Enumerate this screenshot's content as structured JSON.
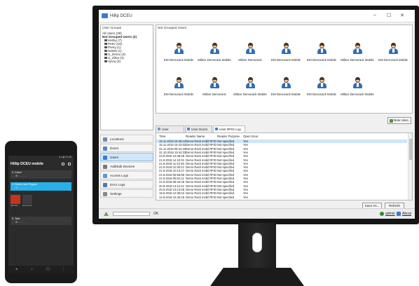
{
  "window": {
    "title": "Hillip DCEU",
    "minimize": "–",
    "maximize": "☐",
    "close": "✕"
  },
  "user_groups": {
    "title": "User Groups",
    "items": [
      {
        "label": "All Users (39)",
        "bold": false,
        "sub": false
      },
      {
        "label": "Not Grouped Users (2)",
        "bold": true,
        "sub": false
      },
      {
        "label": "Hezky (7)",
        "bold": false,
        "sub": true
      },
      {
        "label": "Petrv (18)",
        "bold": false,
        "sub": true
      },
      {
        "label": "Pvery (1)",
        "bold": false,
        "sub": true
      },
      {
        "label": "Sasek (1)",
        "bold": false,
        "sub": true
      },
      {
        "label": "U_Demo (3)",
        "bold": false,
        "sub": true
      },
      {
        "label": "U_Zlina (4)",
        "bold": false,
        "sub": true
      },
      {
        "label": "Vyvoj (3)",
        "bold": false,
        "sub": true
      }
    ]
  },
  "nav": [
    {
      "label": "Locations",
      "color": "#6b8fb5",
      "active": false
    },
    {
      "label": "Doors",
      "color": "#5c86c2",
      "active": false
    },
    {
      "label": "Users",
      "color": "#3a7bd5",
      "active": true
    },
    {
      "label": "Add/Edit Devices",
      "color": "#7a7a7a",
      "active": false
    },
    {
      "label": "Access Logs",
      "color": "#5b9bd5",
      "active": false
    },
    {
      "label": "Error Logs",
      "color": "#4a78b5",
      "active": false
    },
    {
      "label": "Settings",
      "color": "#8a8a8a",
      "active": false
    }
  ],
  "not_grouped": {
    "title": "Not Grouped Users",
    "row1": [
      "EM Demorack Mobile",
      "Mifare Demorack Mobile",
      "Mifare Demorack",
      "EM Demorack Mobile",
      "EM Demorack Mobile",
      "Mifare Demorack Mobile",
      "EM Demorack Mobile"
    ],
    "row2": [
      "EM Demorack Mobile",
      "Mifare Demorack",
      "Mifare Demorack Mobile",
      "EM Demorack Mobile",
      "EM Demorack Mobile",
      "Mifare Demorack Mobile"
    ]
  },
  "buttons": {
    "new_user": "New User...",
    "save_as": "Save As...",
    "refresh": "Refresh"
  },
  "tabs": [
    {
      "label": "User Parameters",
      "selected": false
    },
    {
      "label": "User Doors",
      "selected": false
    },
    {
      "label": "User RFID Log",
      "selected": true
    }
  ],
  "log": {
    "columns": [
      "Time",
      "Reader Name",
      "Reader Purpose",
      "Open Door"
    ],
    "rows": [
      [
        "15.11.2018 15:45:12",
        "Demo Rack mobil RFID",
        "Not specified",
        "Yes"
      ],
      [
        "15.11.2018 15:42:52",
        "Demo Rack mobil RFID",
        "Not specified",
        "Yes"
      ],
      [
        "31.11.2018 08:31:23",
        "Demo Rack mobil RFID",
        "Not specified",
        "Yes"
      ],
      [
        "31.10.2018 15:44:33",
        "Demo Rack mobil RFID",
        "Not specified",
        "Yes"
      ],
      [
        "24.9.2018 13:38:48",
        "Demo Rack mobil RFID",
        "Not specified",
        "Yes"
      ],
      [
        "21.9.2018 14:10:31",
        "Demo Rack mobil RFID",
        "Not specified",
        "Yes"
      ],
      [
        "21.9.2018 11:42:48",
        "Demo Rack mobil RFID",
        "Not specified",
        "Yes"
      ],
      [
        "21.9.2018 10:30:21",
        "Demo Rack mobil RFID",
        "Not specified",
        "Yes"
      ],
      [
        "21.9.2018 10:13:47",
        "Demo Rack mobil RFID",
        "Not specified",
        "Yes"
      ],
      [
        "21.9.2018 09:56:58",
        "Demo Rack mobil RFID",
        "Not specified",
        "Yes"
      ],
      [
        "21.9.2018 09:51:11",
        "Demo Rack mobil RFID",
        "Not specified",
        "Yes"
      ],
      [
        "21.9.2018 08:44:48",
        "Demo Rack mobil RFID",
        "Not specified",
        "Yes"
      ],
      [
        "20.9.2018 13:14:41",
        "Demo Rack mobil RFID",
        "Not specified",
        "Yes"
      ],
      [
        "20.9.2018 13:14:08",
        "Demo Rack mobil RFID",
        "Not specified",
        "Yes"
      ],
      [
        "18.9.2018 12:36:22",
        "Demo Rack mobil RFID",
        "Not specified",
        "Yes"
      ],
      [
        "14.9.2018 16:45:18",
        "Demo Rack mobil RFID",
        "Not specified",
        "Yes"
      ]
    ]
  },
  "status": {
    "text": "OK",
    "user": "admin",
    "about": "About"
  },
  "phone": {
    "status": "▾ ▴ ▮ 12:48",
    "title": "Hillip DCEU mobile",
    "cards": [
      {
        "label": "0. Kanci",
        "sub": "- ⊞ - - -",
        "highlight": false
      },
      {
        "label": "1. Demo rack Prague",
        "sub": "- ⊞ - - -",
        "highlight": true
      },
      {
        "label": "3. Test",
        "sub": "- ⊞ - - -",
        "highlight": false
      }
    ],
    "tiles": [
      {
        "label": "door lock",
        "red": true
      },
      {
        "label": "second exit",
        "red": false
      }
    ],
    "nav": [
      "◂",
      "⌂",
      "▢",
      "⋮"
    ]
  }
}
